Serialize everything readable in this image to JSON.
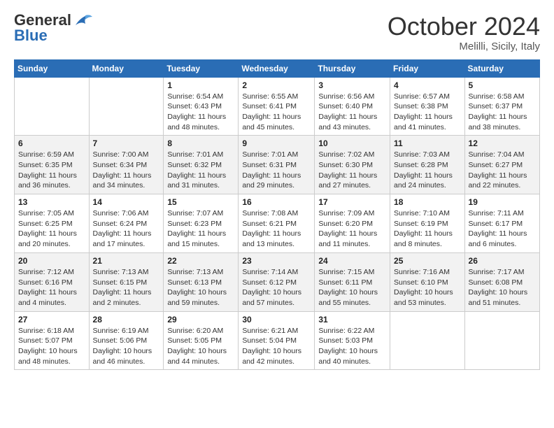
{
  "header": {
    "logo_general": "General",
    "logo_blue": "Blue",
    "month_title": "October 2024",
    "location": "Melilli, Sicily, Italy"
  },
  "weekdays": [
    "Sunday",
    "Monday",
    "Tuesday",
    "Wednesday",
    "Thursday",
    "Friday",
    "Saturday"
  ],
  "weeks": [
    [
      {
        "day": "",
        "info": ""
      },
      {
        "day": "",
        "info": ""
      },
      {
        "day": "1",
        "info": "Sunrise: 6:54 AM\nSunset: 6:43 PM\nDaylight: 11 hours and 48 minutes."
      },
      {
        "day": "2",
        "info": "Sunrise: 6:55 AM\nSunset: 6:41 PM\nDaylight: 11 hours and 45 minutes."
      },
      {
        "day": "3",
        "info": "Sunrise: 6:56 AM\nSunset: 6:40 PM\nDaylight: 11 hours and 43 minutes."
      },
      {
        "day": "4",
        "info": "Sunrise: 6:57 AM\nSunset: 6:38 PM\nDaylight: 11 hours and 41 minutes."
      },
      {
        "day": "5",
        "info": "Sunrise: 6:58 AM\nSunset: 6:37 PM\nDaylight: 11 hours and 38 minutes."
      }
    ],
    [
      {
        "day": "6",
        "info": "Sunrise: 6:59 AM\nSunset: 6:35 PM\nDaylight: 11 hours and 36 minutes."
      },
      {
        "day": "7",
        "info": "Sunrise: 7:00 AM\nSunset: 6:34 PM\nDaylight: 11 hours and 34 minutes."
      },
      {
        "day": "8",
        "info": "Sunrise: 7:01 AM\nSunset: 6:32 PM\nDaylight: 11 hours and 31 minutes."
      },
      {
        "day": "9",
        "info": "Sunrise: 7:01 AM\nSunset: 6:31 PM\nDaylight: 11 hours and 29 minutes."
      },
      {
        "day": "10",
        "info": "Sunrise: 7:02 AM\nSunset: 6:30 PM\nDaylight: 11 hours and 27 minutes."
      },
      {
        "day": "11",
        "info": "Sunrise: 7:03 AM\nSunset: 6:28 PM\nDaylight: 11 hours and 24 minutes."
      },
      {
        "day": "12",
        "info": "Sunrise: 7:04 AM\nSunset: 6:27 PM\nDaylight: 11 hours and 22 minutes."
      }
    ],
    [
      {
        "day": "13",
        "info": "Sunrise: 7:05 AM\nSunset: 6:25 PM\nDaylight: 11 hours and 20 minutes."
      },
      {
        "day": "14",
        "info": "Sunrise: 7:06 AM\nSunset: 6:24 PM\nDaylight: 11 hours and 17 minutes."
      },
      {
        "day": "15",
        "info": "Sunrise: 7:07 AM\nSunset: 6:23 PM\nDaylight: 11 hours and 15 minutes."
      },
      {
        "day": "16",
        "info": "Sunrise: 7:08 AM\nSunset: 6:21 PM\nDaylight: 11 hours and 13 minutes."
      },
      {
        "day": "17",
        "info": "Sunrise: 7:09 AM\nSunset: 6:20 PM\nDaylight: 11 hours and 11 minutes."
      },
      {
        "day": "18",
        "info": "Sunrise: 7:10 AM\nSunset: 6:19 PM\nDaylight: 11 hours and 8 minutes."
      },
      {
        "day": "19",
        "info": "Sunrise: 7:11 AM\nSunset: 6:17 PM\nDaylight: 11 hours and 6 minutes."
      }
    ],
    [
      {
        "day": "20",
        "info": "Sunrise: 7:12 AM\nSunset: 6:16 PM\nDaylight: 11 hours and 4 minutes."
      },
      {
        "day": "21",
        "info": "Sunrise: 7:13 AM\nSunset: 6:15 PM\nDaylight: 11 hours and 2 minutes."
      },
      {
        "day": "22",
        "info": "Sunrise: 7:13 AM\nSunset: 6:13 PM\nDaylight: 10 hours and 59 minutes."
      },
      {
        "day": "23",
        "info": "Sunrise: 7:14 AM\nSunset: 6:12 PM\nDaylight: 10 hours and 57 minutes."
      },
      {
        "day": "24",
        "info": "Sunrise: 7:15 AM\nSunset: 6:11 PM\nDaylight: 10 hours and 55 minutes."
      },
      {
        "day": "25",
        "info": "Sunrise: 7:16 AM\nSunset: 6:10 PM\nDaylight: 10 hours and 53 minutes."
      },
      {
        "day": "26",
        "info": "Sunrise: 7:17 AM\nSunset: 6:08 PM\nDaylight: 10 hours and 51 minutes."
      }
    ],
    [
      {
        "day": "27",
        "info": "Sunrise: 6:18 AM\nSunset: 5:07 PM\nDaylight: 10 hours and 48 minutes."
      },
      {
        "day": "28",
        "info": "Sunrise: 6:19 AM\nSunset: 5:06 PM\nDaylight: 10 hours and 46 minutes."
      },
      {
        "day": "29",
        "info": "Sunrise: 6:20 AM\nSunset: 5:05 PM\nDaylight: 10 hours and 44 minutes."
      },
      {
        "day": "30",
        "info": "Sunrise: 6:21 AM\nSunset: 5:04 PM\nDaylight: 10 hours and 42 minutes."
      },
      {
        "day": "31",
        "info": "Sunrise: 6:22 AM\nSunset: 5:03 PM\nDaylight: 10 hours and 40 minutes."
      },
      {
        "day": "",
        "info": ""
      },
      {
        "day": "",
        "info": ""
      }
    ]
  ]
}
